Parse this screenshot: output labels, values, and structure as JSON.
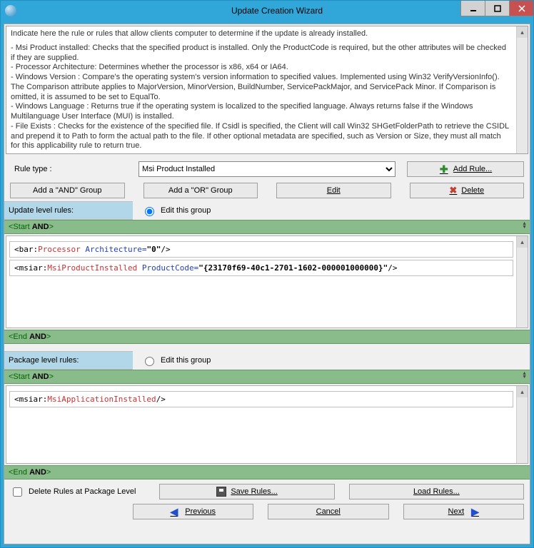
{
  "title": "Update Creation Wizard",
  "help": {
    "intro": "Indicate here the rule or rules that allow clients computer to determine if the update is already installed.",
    "msi": " - Msi Product installed: Checks that the specified product is installed. Only the ProductCode is required, but the other attributes will be checked if they are supplied.",
    "proc": " - Processor Architecture: Determines whether the processor is x86, x64 or IA64.",
    "winver": " - Windows Version : Compare's the operating system's version information to specified values.  Implemented using Win32 VerifyVersionInfo().  The Comparison attribute applies to MajorVersion, MinorVersion, BuildNumber, ServicePackMajor, and ServicePack Minor.  If Comparison is omitted, it is assumed to be set to EqualTo.",
    "winlang": " - Windows Language : Returns true if the operating system is localized to the specified language.  Always returns false if the Windows Multilanguage User Interface (MUI) is installed.",
    "fileexists": " - File Exists : Checks for the existence of the specified file.  If Csidl is specified, the Client will call Win32 SHGetFolderPath to retrieve the CSIDL and prepend it to Path to form the actual path to the file. If other optional metadata are specified, such as Version or Size, they must all match for this applicability rule to return true."
  },
  "ruleTypeLabel": "Rule type :",
  "ruleTypeValue": "Msi Product Installed",
  "buttons": {
    "addRule": "Add Rule...",
    "addAnd": "Add a \"AND\" Group",
    "addOr": "Add a \"OR\" Group",
    "edit": "Edit",
    "delete": "Delete",
    "saveRules": "Save Rules...",
    "loadRules": "Load Rules...",
    "previous": "Previous",
    "cancel": "Cancel",
    "next": "Next"
  },
  "sections": {
    "updateLevel": "Update level rules:",
    "packageLevel": "Package level rules:",
    "editThisGroup": "Edit this group",
    "startAnd": "<Start AND>",
    "endAnd": "<End AND>"
  },
  "rules": {
    "proc_tag": "<bar:",
    "proc_name": "Processor",
    "proc_attr": " Architecture=",
    "proc_val": "\"0\"",
    "proc_close": "/>",
    "msi_tag": "<msiar:",
    "msi_name": "MsiProductInstalled",
    "msi_attr": " ProductCode=",
    "msi_val": "\"{23170f69-40c1-2701-1602-000001000000}\"",
    "msi_close": "/>",
    "app_tag": "<msiar:",
    "app_name": "MsiApplicationInstalled",
    "app_close": "/>"
  },
  "deleteRulesAtPkg": "Delete Rules at Package Level"
}
